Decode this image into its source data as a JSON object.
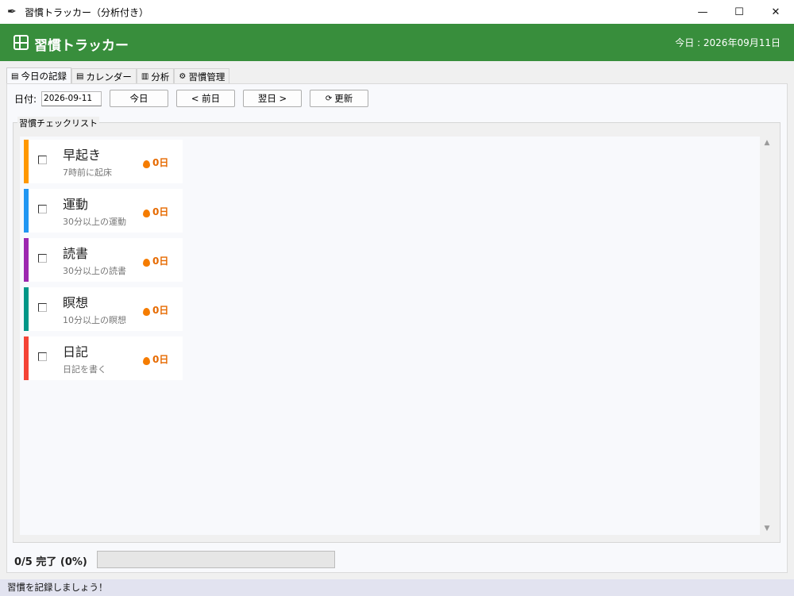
{
  "window": {
    "title": "習慣トラッカー（分析付き）",
    "controls": {
      "minimize": "—",
      "maximize": "☐",
      "close": "✕"
    }
  },
  "header": {
    "title": "習慣トラッカー",
    "today_label": "今日 : 2026年09月11日"
  },
  "tabs": [
    {
      "label": "今日の記録",
      "icon": "calendar-icon",
      "glyph": "▤"
    },
    {
      "label": "カレンダー",
      "icon": "calendar-icon",
      "glyph": "▤"
    },
    {
      "label": "分析",
      "icon": "chart-icon",
      "glyph": "▥"
    },
    {
      "label": "習慣管理",
      "icon": "gear-icon",
      "glyph": "⚙"
    }
  ],
  "toolbar": {
    "date_label": "日付:",
    "date_value": "2026-09-11",
    "today_button": "今日",
    "prev_button": "< 前日",
    "next_button": "翌日 >",
    "refresh_button": "更新",
    "refresh_glyph": "⟳"
  },
  "checklist": {
    "label": "習慣チェックリスト",
    "scroll_up": "▲",
    "scroll_down": "▼",
    "habits": [
      {
        "name": "早起き",
        "desc": "7時前に起床",
        "streak": "0日",
        "color": "#ff9800",
        "checked": false
      },
      {
        "name": "運動",
        "desc": "30分以上の運動",
        "streak": "0日",
        "color": "#2196f3",
        "checked": false
      },
      {
        "name": "読書",
        "desc": "30分以上の読書",
        "streak": "0日",
        "color": "#9c27b0",
        "checked": false
      },
      {
        "name": "瞑想",
        "desc": "10分以上の瞑想",
        "streak": "0日",
        "color": "#009688",
        "checked": false
      },
      {
        "name": "日記",
        "desc": "日記を書く",
        "streak": "0日",
        "color": "#f44336",
        "checked": false
      }
    ]
  },
  "progress": {
    "text": "0/5 完了 (0%)",
    "fraction": 0
  },
  "status": {
    "text": "習慣を記録しましょう！"
  }
}
